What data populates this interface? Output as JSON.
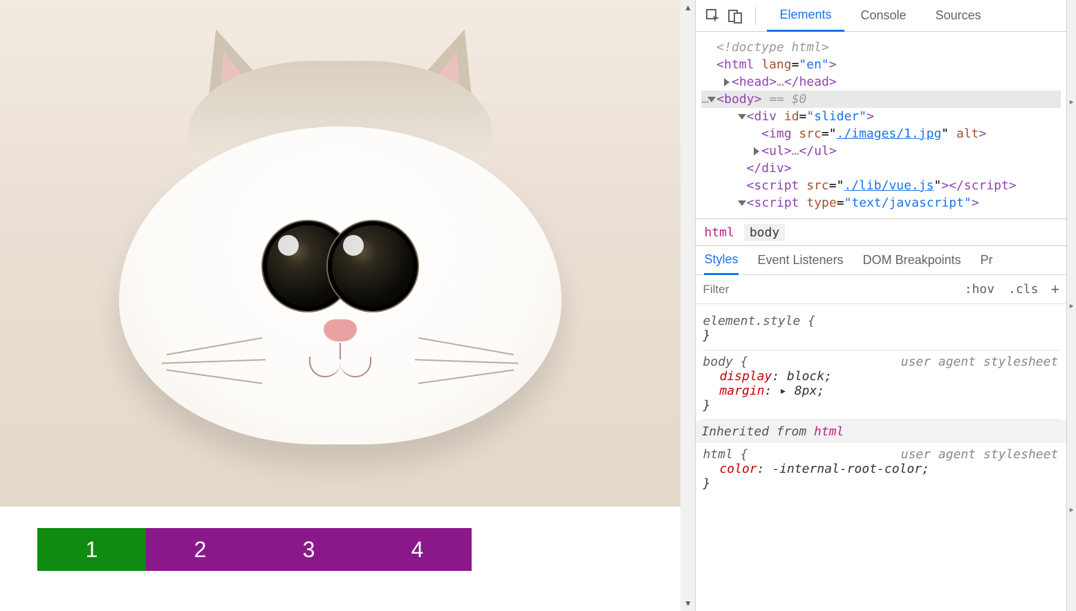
{
  "page": {
    "pager_items": [
      "1",
      "2",
      "3",
      "4"
    ],
    "active_index": 0
  },
  "devtools": {
    "tabs": {
      "elements": "Elements",
      "console": "Console",
      "sources": "Sources"
    },
    "dom": {
      "doctype": "<!doctype html>",
      "html_open": "<html lang=\"en\">",
      "head": "<head>…</head>",
      "body_open": "<body>",
      "body_eq": " == $0",
      "div_open": "<div id=\"slider\">",
      "img_text_pre": "<img src=\"",
      "img_link": "./images/1.jpg",
      "img_text_post": "\" alt>",
      "ul": "<ul>…</ul>",
      "div_close": "</div>",
      "script1_pre": "<script src=\"",
      "script1_link": "./lib/vue.js",
      "script1_post": "\"></script",
      "script2": "<script type=\"text/javascript\">"
    },
    "breadcrumb": {
      "html": "html",
      "body": "body"
    },
    "styles_tabs": {
      "styles": "Styles",
      "event": "Event Listeners",
      "dom_bp": "DOM Breakpoints",
      "pr": "Pr"
    },
    "filter_placeholder": "Filter",
    "hov": ":hov",
    "cls": ".cls",
    "rules": {
      "element_style": "element.style {",
      "close": "}",
      "body_sel": "body {",
      "uastyle": "user agent stylesheet",
      "display_name": "display",
      "display_val": ": block;",
      "margin_name": "margin",
      "margin_val": ": ▸ 8px;",
      "inherited": "Inherited from ",
      "inherited_html": "html",
      "html_sel": "html {",
      "color_name": "color",
      "color_val": ": -internal-root-color;"
    }
  }
}
